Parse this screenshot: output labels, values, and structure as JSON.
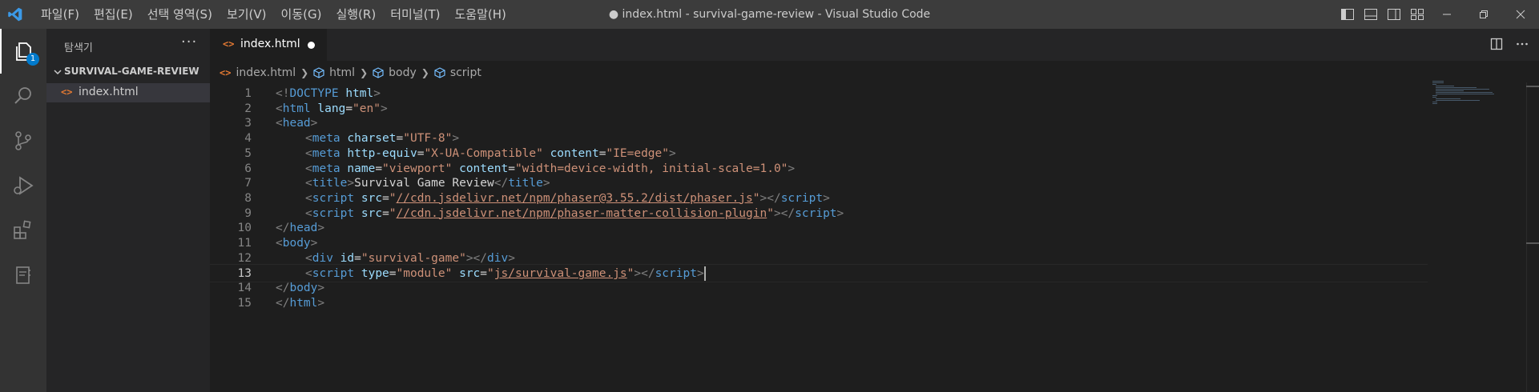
{
  "window": {
    "title": "● index.html - survival-game-review - Visual Studio Code",
    "menu": [
      "파일(F)",
      "편집(E)",
      "선택 영역(S)",
      "보기(V)",
      "이동(G)",
      "실행(R)",
      "터미널(T)",
      "도움말(H)"
    ]
  },
  "activity_bar": {
    "explorer_badge": "1",
    "icons": [
      "explorer-icon",
      "search-icon",
      "source-control-icon",
      "run-debug-icon",
      "extensions-icon",
      "notebook-icon"
    ]
  },
  "sidebar": {
    "title": "탐색기",
    "more": "···",
    "section": "SURVIVAL-GAME-REVIEW",
    "files": [
      {
        "icon": "<>",
        "name": "index.html"
      }
    ]
  },
  "tab": {
    "icon": "<>",
    "name": "index.html"
  },
  "breadcrumbs": [
    "index.html",
    "html",
    "body",
    "script"
  ],
  "editor": {
    "current_line": 13,
    "lines": [
      {
        "n": "1",
        "parts": [
          [
            "punct",
            "<!"
          ],
          [
            "tag",
            "DOCTYPE"
          ],
          [
            "txt",
            " "
          ],
          [
            "attr",
            "html"
          ],
          [
            "punct",
            ">"
          ]
        ]
      },
      {
        "n": "2",
        "parts": [
          [
            "punct",
            "<"
          ],
          [
            "tag",
            "html"
          ],
          [
            "txt",
            " "
          ],
          [
            "attr",
            "lang"
          ],
          [
            "txt",
            "="
          ],
          [
            "str",
            "\"en\""
          ],
          [
            "punct",
            ">"
          ]
        ]
      },
      {
        "n": "3",
        "parts": [
          [
            "punct",
            "<"
          ],
          [
            "tag",
            "head"
          ],
          [
            "punct",
            ">"
          ]
        ]
      },
      {
        "n": "4",
        "indent": 1,
        "parts": [
          [
            "punct",
            "<"
          ],
          [
            "tag",
            "meta"
          ],
          [
            "txt",
            " "
          ],
          [
            "attr",
            "charset"
          ],
          [
            "txt",
            "="
          ],
          [
            "str",
            "\"UTF-8\""
          ],
          [
            "punct",
            ">"
          ]
        ]
      },
      {
        "n": "5",
        "indent": 1,
        "parts": [
          [
            "punct",
            "<"
          ],
          [
            "tag",
            "meta"
          ],
          [
            "txt",
            " "
          ],
          [
            "attr",
            "http-equiv"
          ],
          [
            "txt",
            "="
          ],
          [
            "str",
            "\"X-UA-Compatible\""
          ],
          [
            "txt",
            " "
          ],
          [
            "attr",
            "content"
          ],
          [
            "txt",
            "="
          ],
          [
            "str",
            "\"IE=edge\""
          ],
          [
            "punct",
            ">"
          ]
        ]
      },
      {
        "n": "6",
        "indent": 1,
        "parts": [
          [
            "punct",
            "<"
          ],
          [
            "tag",
            "meta"
          ],
          [
            "txt",
            " "
          ],
          [
            "attr",
            "name"
          ],
          [
            "txt",
            "="
          ],
          [
            "str",
            "\"viewport\""
          ],
          [
            "txt",
            " "
          ],
          [
            "attr",
            "content"
          ],
          [
            "txt",
            "="
          ],
          [
            "str",
            "\"width=device-width, initial-scale=1.0\""
          ],
          [
            "punct",
            ">"
          ]
        ]
      },
      {
        "n": "7",
        "indent": 1,
        "parts": [
          [
            "punct",
            "<"
          ],
          [
            "tag",
            "title"
          ],
          [
            "punct",
            ">"
          ],
          [
            "txt",
            "Survival Game Review"
          ],
          [
            "punct",
            "</"
          ],
          [
            "tag",
            "title"
          ],
          [
            "punct",
            ">"
          ]
        ]
      },
      {
        "n": "8",
        "indent": 1,
        "parts": [
          [
            "punct",
            "<"
          ],
          [
            "tag",
            "script"
          ],
          [
            "txt",
            " "
          ],
          [
            "attr",
            "src"
          ],
          [
            "txt",
            "="
          ],
          [
            "str",
            "\""
          ],
          [
            "str link",
            "//cdn.jsdelivr.net/npm/phaser@3.55.2/dist/phaser.js"
          ],
          [
            "str",
            "\""
          ],
          [
            "punct",
            "></"
          ],
          [
            "tag",
            "script"
          ],
          [
            "punct",
            ">"
          ]
        ]
      },
      {
        "n": "9",
        "indent": 1,
        "parts": [
          [
            "punct",
            "<"
          ],
          [
            "tag",
            "script"
          ],
          [
            "txt",
            " "
          ],
          [
            "attr",
            "src"
          ],
          [
            "txt",
            "="
          ],
          [
            "str",
            "\""
          ],
          [
            "str link",
            "//cdn.jsdelivr.net/npm/phaser-matter-collision-plugin"
          ],
          [
            "str",
            "\""
          ],
          [
            "punct",
            "></"
          ],
          [
            "tag",
            "script"
          ],
          [
            "punct",
            ">"
          ]
        ]
      },
      {
        "n": "10",
        "parts": [
          [
            "punct",
            "</"
          ],
          [
            "tag",
            "head"
          ],
          [
            "punct",
            ">"
          ]
        ]
      },
      {
        "n": "11",
        "parts": [
          [
            "punct",
            "<"
          ],
          [
            "tag",
            "body"
          ],
          [
            "punct",
            ">"
          ]
        ]
      },
      {
        "n": "12",
        "indent": 1,
        "parts": [
          [
            "punct",
            "<"
          ],
          [
            "tag",
            "div"
          ],
          [
            "txt",
            " "
          ],
          [
            "attr",
            "id"
          ],
          [
            "txt",
            "="
          ],
          [
            "str",
            "\"survival-game\""
          ],
          [
            "punct",
            "></"
          ],
          [
            "tag",
            "div"
          ],
          [
            "punct",
            ">"
          ]
        ]
      },
      {
        "n": "13",
        "indent": 1,
        "parts": [
          [
            "punct",
            "<"
          ],
          [
            "tag",
            "script"
          ],
          [
            "txt",
            " "
          ],
          [
            "attr",
            "type"
          ],
          [
            "txt",
            "="
          ],
          [
            "str",
            "\"module\""
          ],
          [
            "txt",
            " "
          ],
          [
            "attr",
            "src"
          ],
          [
            "txt",
            "="
          ],
          [
            "str",
            "\""
          ],
          [
            "str link",
            "js/survival-game.js"
          ],
          [
            "str",
            "\""
          ],
          [
            "punct",
            "></"
          ],
          [
            "tag",
            "script"
          ],
          [
            "punct",
            ">"
          ]
        ],
        "cursor": true
      },
      {
        "n": "14",
        "parts": [
          [
            "punct",
            "</"
          ],
          [
            "tag",
            "body"
          ],
          [
            "punct",
            ">"
          ]
        ]
      },
      {
        "n": "15",
        "parts": [
          [
            "punct",
            "</"
          ],
          [
            "tag",
            "html"
          ],
          [
            "punct",
            ">"
          ]
        ]
      }
    ]
  },
  "colors": {
    "accent": "#007acc",
    "tag": "#569cd6",
    "attribute": "#9cdcfe",
    "string": "#ce9178",
    "html_file_icon": "#e37933"
  }
}
